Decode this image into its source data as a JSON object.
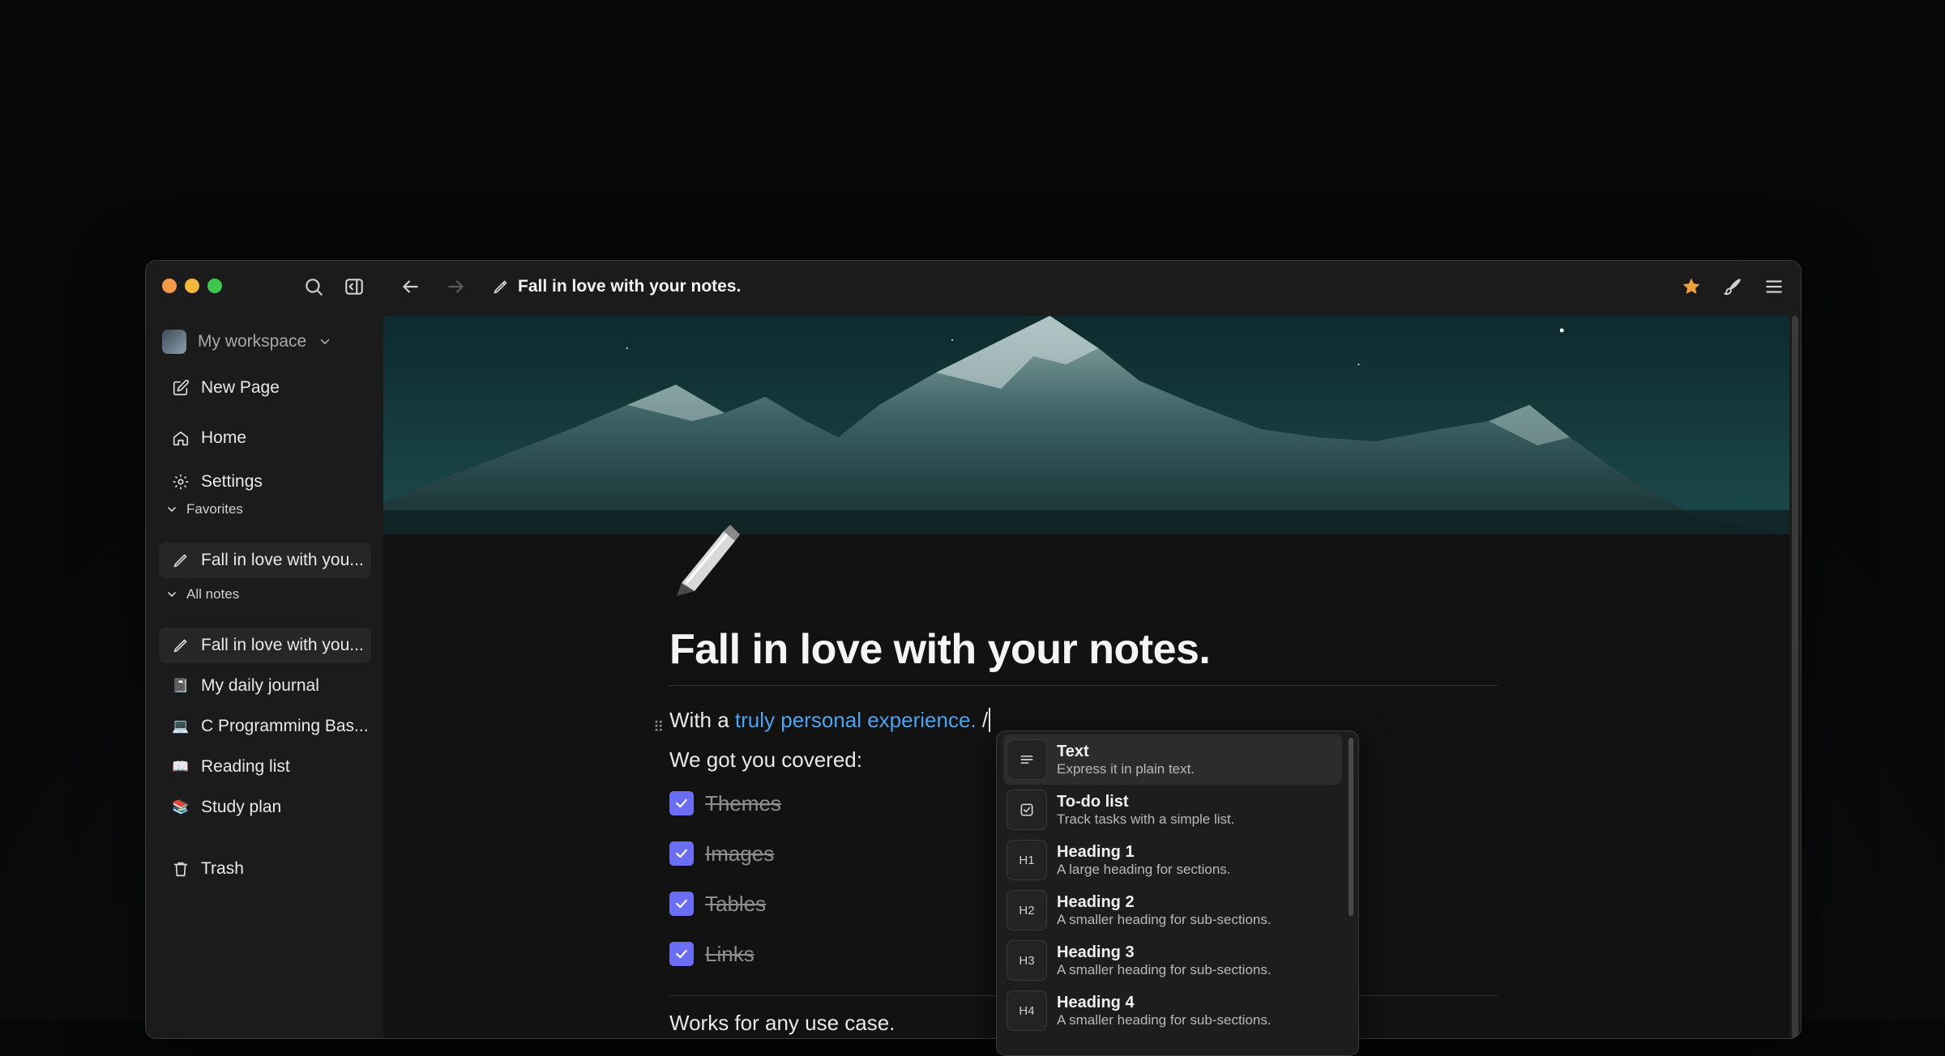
{
  "window": {
    "page_title": "Fall in love with your notes."
  },
  "sidebar": {
    "workspace": "My workspace",
    "new_page": "New Page",
    "home": "Home",
    "settings": "Settings",
    "favorites_label": "Favorites",
    "favorites": [
      {
        "icon": "pen-icon",
        "label": "Fall in love with you..."
      }
    ],
    "all_notes_label": "All notes",
    "notes": [
      {
        "icon": "pen-icon",
        "label": "Fall in love with you..."
      },
      {
        "icon": "📓",
        "label": "My daily journal"
      },
      {
        "icon": "💻",
        "label": "C Programming Bas..."
      },
      {
        "icon": "📖",
        "label": "Reading list"
      },
      {
        "icon": "📚",
        "label": "Study plan"
      }
    ],
    "trash": "Trash"
  },
  "page": {
    "title": "Fall in love with your notes.",
    "line1_prefix": "With a ",
    "line1_link": "truly personal experience.",
    "line1_suffix": " /",
    "line2": "We got you covered:",
    "todos": [
      {
        "label": "Themes",
        "checked": true
      },
      {
        "label": "Images",
        "checked": true
      },
      {
        "label": "Tables",
        "checked": true
      },
      {
        "label": "Links",
        "checked": true
      }
    ],
    "partial_line": "Works for any use case."
  },
  "slash_menu": {
    "items": [
      {
        "icon": "text-lines-icon",
        "label": "Text",
        "desc": "Express it in plain text."
      },
      {
        "icon": "checkbox-icon",
        "label": "To-do list",
        "desc": "Track tasks with a simple list."
      },
      {
        "icon": "H1",
        "label": "Heading 1",
        "desc": "A large heading for sections."
      },
      {
        "icon": "H2",
        "label": "Heading 2",
        "desc": "A smaller heading for sub-sections."
      },
      {
        "icon": "H3",
        "label": "Heading 3",
        "desc": "A smaller heading for sub-sections."
      },
      {
        "icon": "H4",
        "label": "Heading 4",
        "desc": "A smaller heading for sub-sections."
      }
    ]
  },
  "colors": {
    "accent_link": "#4da3ef",
    "checkbox": "#6b6ef2",
    "star": "#f0a23a"
  }
}
